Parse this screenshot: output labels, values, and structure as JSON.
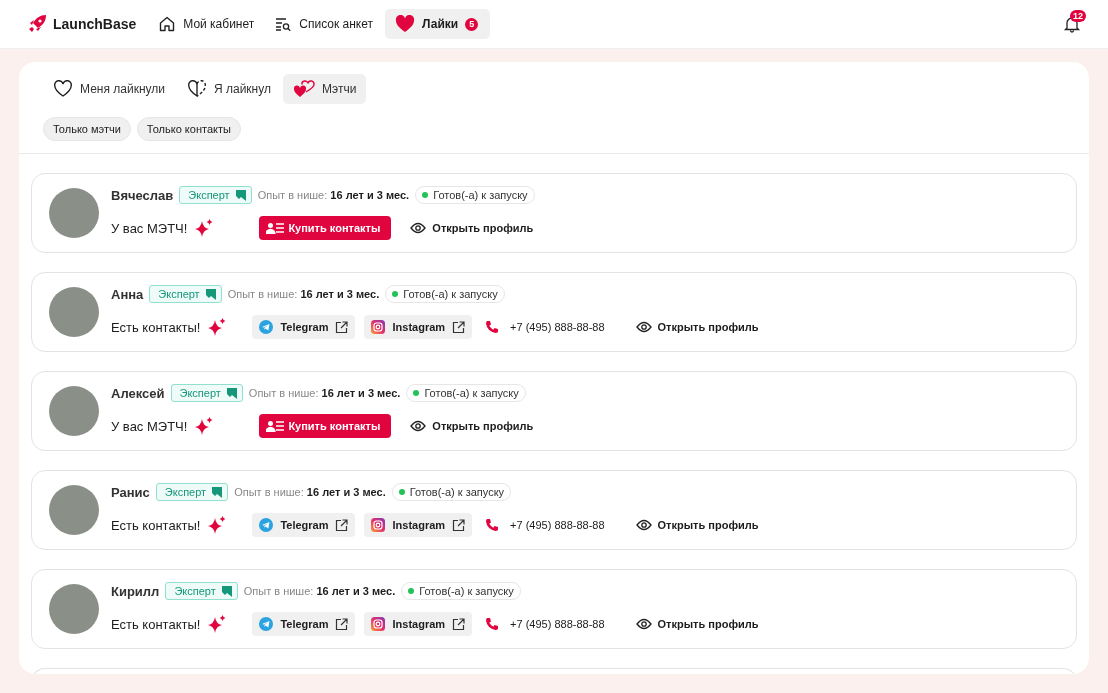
{
  "header": {
    "logo": "LaunchBase",
    "nav": [
      {
        "label": "Мой кабинет",
        "kind": "home",
        "selected": false
      },
      {
        "label": "Список анкет",
        "kind": "list",
        "selected": false
      },
      {
        "label": "Лайки",
        "kind": "heart",
        "selected": true,
        "badge": "5"
      }
    ],
    "notifications_badge": "12"
  },
  "tabs": [
    {
      "label": "Меня лайкнули",
      "kind": "liked-me",
      "selected": false
    },
    {
      "label": "Я лайкнул",
      "kind": "liked",
      "selected": false
    },
    {
      "label": "Мэтчи",
      "kind": "matches",
      "selected": true
    }
  ],
  "filters": [
    {
      "label": "Только мэтчи",
      "selected": false
    },
    {
      "label": "Только контакты",
      "selected": false
    }
  ],
  "profiles": [
    {
      "name": "Вячеслав",
      "badge": "Эксперт",
      "experience_label": "Опыт в нише:",
      "experience": "16 лет и 3 мес.",
      "status": "Готов(-а) к запуску",
      "kind": "match",
      "message": "У вас МЭТЧ!",
      "action": "Купить контакты",
      "open": "Открыть профиль"
    },
    {
      "name": "Анна",
      "badge": "Эксперт",
      "experience_label": "Опыт в нише:",
      "experience": "16 лет и 3 мес.",
      "status": "Готов(-а) к запуску",
      "kind": "contacts",
      "message": "Есть контакты!",
      "telegram": "Telegram",
      "instagram": "Instagram",
      "phone": "+7 (495) 888-88-88",
      "open": "Открыть профиль"
    },
    {
      "name": "Алексей",
      "badge": "Эксперт",
      "experience_label": "Опыт в нише:",
      "experience": "16 лет и 3 мес.",
      "status": "Готов(-а) к запуску",
      "kind": "match",
      "message": "У вас МЭТЧ!",
      "action": "Купить контакты",
      "open": "Открыть профиль"
    },
    {
      "name": "Ранис",
      "badge": "Эксперт",
      "experience_label": "Опыт в нише:",
      "experience": "16 лет и 3 мес.",
      "status": "Готов(-а) к запуску",
      "kind": "contacts",
      "message": "Есть контакты!",
      "telegram": "Telegram",
      "instagram": "Instagram",
      "phone": "+7 (495) 888-88-88",
      "open": "Открыть профиль"
    },
    {
      "name": "Кирилл",
      "badge": "Эксперт",
      "experience_label": "Опыт в нише:",
      "experience": "16 лет и 3 мес.",
      "status": "Готов(-а) к запуску",
      "kind": "contacts",
      "message": "Есть контакты!",
      "telegram": "Telegram",
      "instagram": "Instagram",
      "phone": "+7 (495) 888-88-88",
      "open": "Открыть профиль"
    }
  ]
}
